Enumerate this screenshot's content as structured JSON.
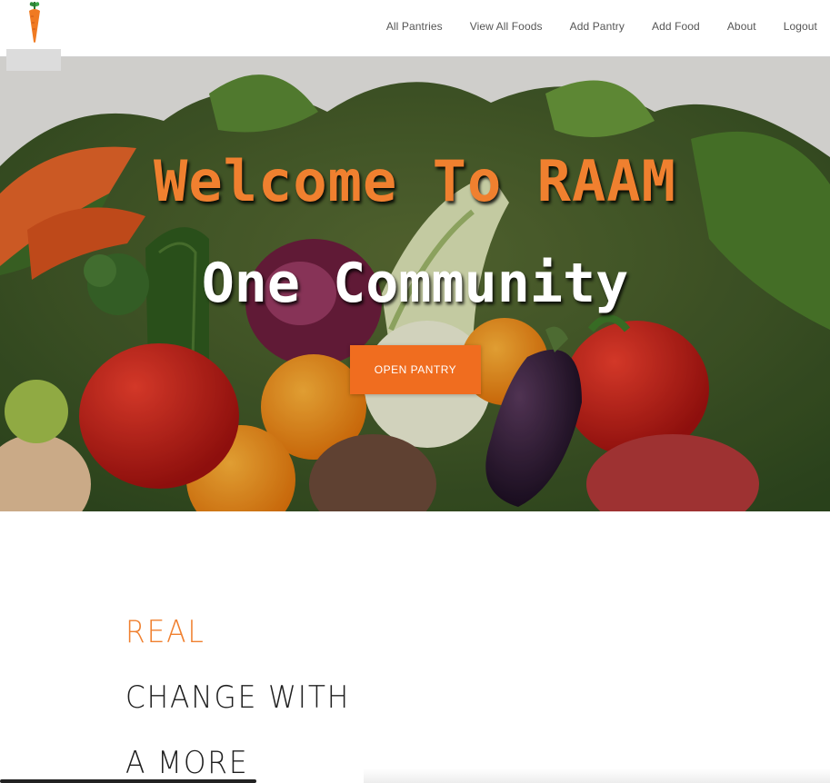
{
  "header": {
    "nav": [
      {
        "label": "All Pantries"
      },
      {
        "label": "View All Foods"
      },
      {
        "label": "Add Pantry"
      },
      {
        "label": "Add Food"
      },
      {
        "label": "About"
      },
      {
        "label": "Logout"
      }
    ]
  },
  "hero": {
    "title": "Welcome To RAAM",
    "subtitle": "One Community",
    "cta_label": "OPEN PANTRY"
  },
  "main": {
    "lines": [
      "REAL",
      "CHANGE WITH",
      "A MORE"
    ]
  },
  "colors": {
    "accent": "#f0802f",
    "button": "#f06d1f",
    "text_dark": "#1f1f1f",
    "nav_text": "#555555"
  },
  "icons": {
    "logo": "carrot-logo-icon"
  }
}
